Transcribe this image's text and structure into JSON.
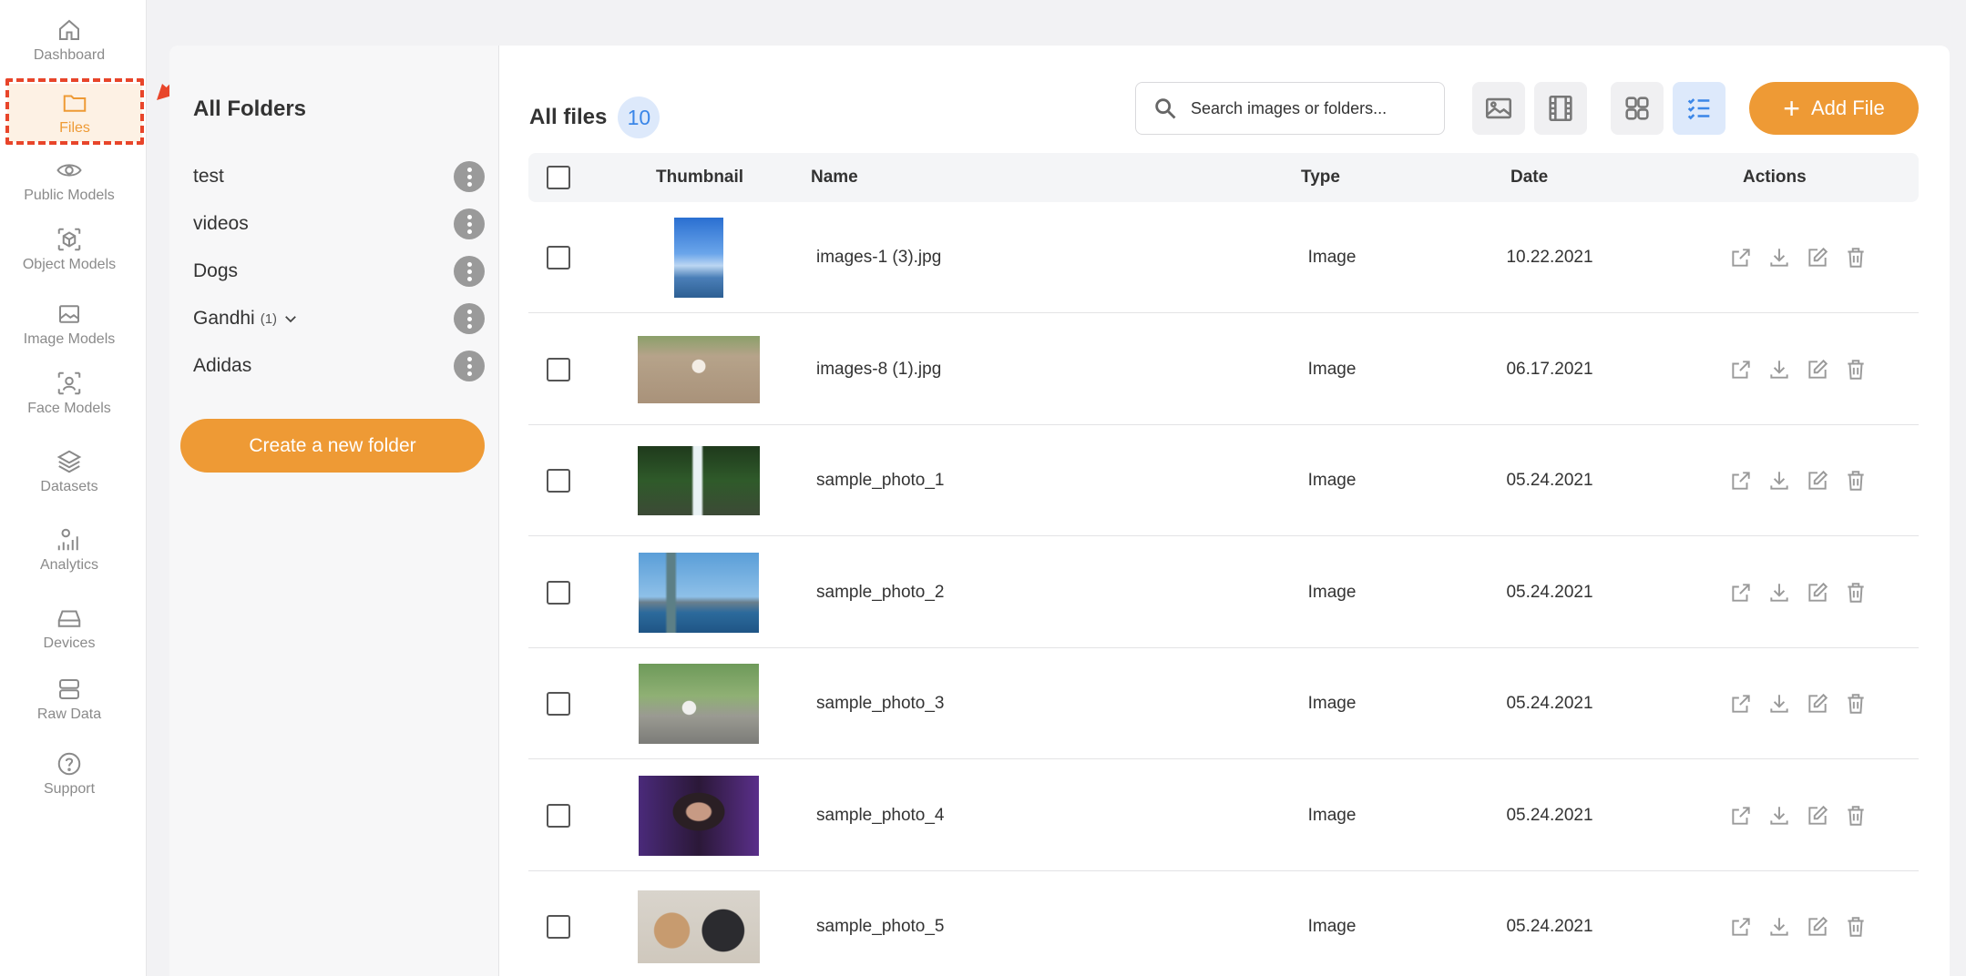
{
  "sidebar": {
    "items": [
      {
        "label": "Dashboard",
        "icon": "home-icon"
      },
      {
        "label": "Files",
        "icon": "folder-icon",
        "active": true
      },
      {
        "label": "Public Models",
        "icon": "eye-icon"
      },
      {
        "label": "Object Models",
        "icon": "cube-icon"
      },
      {
        "label": "Image Models",
        "icon": "image-icon"
      },
      {
        "label": "Face Models",
        "icon": "face-scan-icon"
      },
      {
        "label": "Datasets",
        "icon": "layers-icon"
      },
      {
        "label": "Analytics",
        "icon": "analytics-icon"
      },
      {
        "label": "Devices",
        "icon": "device-icon"
      },
      {
        "label": "Raw Data",
        "icon": "database-icon"
      },
      {
        "label": "Support",
        "icon": "help-icon"
      }
    ]
  },
  "folders": {
    "title": "All Folders",
    "items": [
      {
        "name": "test"
      },
      {
        "name": "videos"
      },
      {
        "name": "Dogs"
      },
      {
        "name": "Gandhi",
        "count": "(1)"
      },
      {
        "name": "Adidas"
      }
    ],
    "create_label": "Create a new folder"
  },
  "files": {
    "title": "All files",
    "count": "10",
    "search_placeholder": "Search images or folders...",
    "add_label": "Add File",
    "columns": {
      "thumbnail": "Thumbnail",
      "name": "Name",
      "type": "Type",
      "date": "Date",
      "actions": "Actions"
    },
    "rows": [
      {
        "name": "images-1 (3).jpg",
        "type": "Image",
        "date": "10.22.2021",
        "thumb": "sky-sea"
      },
      {
        "name": "images-8 (1).jpg",
        "type": "Image",
        "date": "06.17.2021",
        "thumb": "dog-road"
      },
      {
        "name": "sample_photo_1",
        "type": "Image",
        "date": "05.24.2021",
        "thumb": "waterfall"
      },
      {
        "name": "sample_photo_2",
        "type": "Image",
        "date": "05.24.2021",
        "thumb": "statue-liberty"
      },
      {
        "name": "sample_photo_3",
        "type": "Image",
        "date": "05.24.2021",
        "thumb": "child-bike"
      },
      {
        "name": "sample_photo_4",
        "type": "Image",
        "date": "05.24.2021",
        "thumb": "portrait-man"
      },
      {
        "name": "sample_photo_5",
        "type": "Image",
        "date": "05.24.2021",
        "thumb": "cat-dog"
      }
    ]
  },
  "colors": {
    "accent": "#ee9a35",
    "blue": "#3a86e8",
    "annotation": "#e8452a"
  }
}
